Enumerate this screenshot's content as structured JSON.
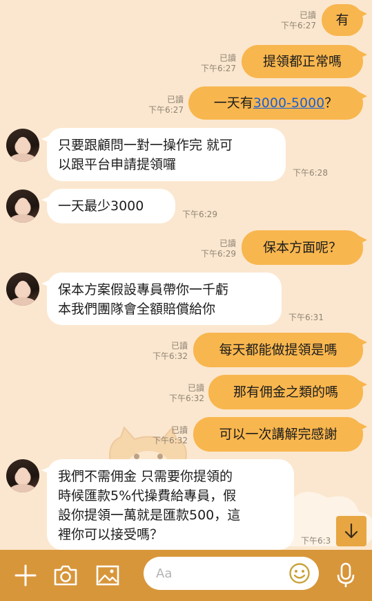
{
  "colors": {
    "outgoing": "#f8b64e",
    "incoming": "#ffffff",
    "background": "#fbe7cf",
    "bottom_bar": "#d8963a",
    "link": "#1a5fd4"
  },
  "messages": [
    {
      "dir": "out",
      "text": "有",
      "read": "已讀",
      "time": "下午6:27"
    },
    {
      "dir": "out",
      "text": "提領都正常嗎",
      "read": "已讀",
      "time": "下午6:27"
    },
    {
      "dir": "out",
      "text_before": "一天有",
      "link": "3000-5000",
      "text_after": "？",
      "read": "已讀",
      "time": "下午6:27"
    },
    {
      "dir": "in",
      "lines": [
        "只要跟顧問一對一操作完 就可",
        "以跟平台申請提領囉"
      ],
      "time": "下午6:28"
    },
    {
      "dir": "in",
      "lines": [
        "一天最少3000"
      ],
      "time": "下午6:29"
    },
    {
      "dir": "out",
      "text": "保本方面呢？",
      "read": "已讀",
      "time": "下午6:29"
    },
    {
      "dir": "in",
      "lines": [
        "保本方案假設專員帶你一千虧",
        "本我們團隊會全額賠償給你"
      ],
      "time": "下午6:31"
    },
    {
      "dir": "out",
      "text": "每天都能做提領是嗎",
      "read": "已讀",
      "time": "下午6:32"
    },
    {
      "dir": "out",
      "text": "那有佣金之類的嗎",
      "read": "已讀",
      "time": "下午6:32"
    },
    {
      "dir": "out",
      "text": "可以一次講解完感謝",
      "read": "已讀",
      "time": "下午6:32"
    },
    {
      "dir": "in",
      "lines": [
        "我們不需佣金 只需要你提領的",
        "時候匯款5%代操費給專員，假",
        "設你提領一萬就是匯款500，這",
        "裡你可以接受嗎？"
      ],
      "time": "下午6:3"
    }
  ],
  "input": {
    "placeholder": "Aa"
  },
  "icons": {
    "add": "plus-icon",
    "camera": "camera-icon",
    "image": "image-icon",
    "emoji": "emoji-icon",
    "mic": "microphone-icon",
    "scroll": "arrow-down-icon"
  }
}
